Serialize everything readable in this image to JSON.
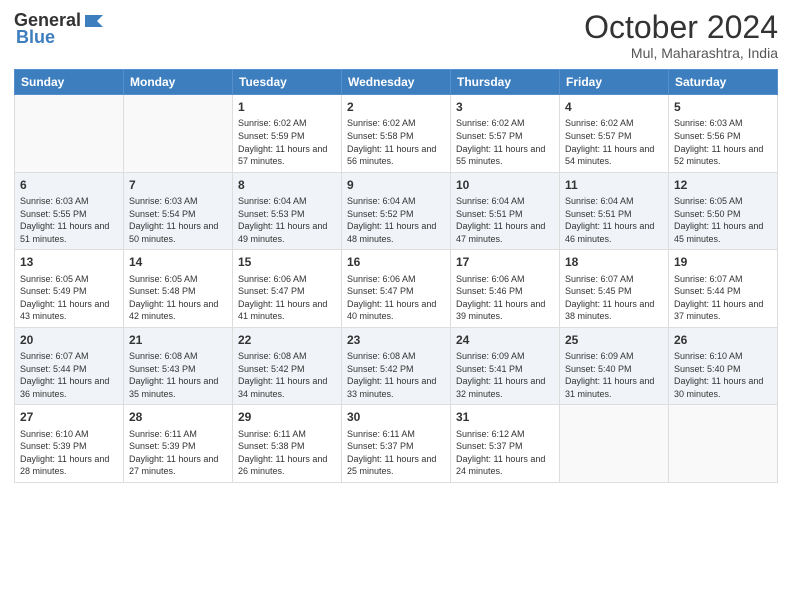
{
  "header": {
    "logo_general": "General",
    "logo_blue": "Blue",
    "month_title": "October 2024",
    "location": "Mul, Maharashtra, India"
  },
  "days_of_week": [
    "Sunday",
    "Monday",
    "Tuesday",
    "Wednesday",
    "Thursday",
    "Friday",
    "Saturday"
  ],
  "weeks": [
    [
      {
        "day": "",
        "sunrise": "",
        "sunset": "",
        "daylight": ""
      },
      {
        "day": "",
        "sunrise": "",
        "sunset": "",
        "daylight": ""
      },
      {
        "day": "1",
        "sunrise": "Sunrise: 6:02 AM",
        "sunset": "Sunset: 5:59 PM",
        "daylight": "Daylight: 11 hours and 57 minutes."
      },
      {
        "day": "2",
        "sunrise": "Sunrise: 6:02 AM",
        "sunset": "Sunset: 5:58 PM",
        "daylight": "Daylight: 11 hours and 56 minutes."
      },
      {
        "day": "3",
        "sunrise": "Sunrise: 6:02 AM",
        "sunset": "Sunset: 5:57 PM",
        "daylight": "Daylight: 11 hours and 55 minutes."
      },
      {
        "day": "4",
        "sunrise": "Sunrise: 6:02 AM",
        "sunset": "Sunset: 5:57 PM",
        "daylight": "Daylight: 11 hours and 54 minutes."
      },
      {
        "day": "5",
        "sunrise": "Sunrise: 6:03 AM",
        "sunset": "Sunset: 5:56 PM",
        "daylight": "Daylight: 11 hours and 52 minutes."
      }
    ],
    [
      {
        "day": "6",
        "sunrise": "Sunrise: 6:03 AM",
        "sunset": "Sunset: 5:55 PM",
        "daylight": "Daylight: 11 hours and 51 minutes."
      },
      {
        "day": "7",
        "sunrise": "Sunrise: 6:03 AM",
        "sunset": "Sunset: 5:54 PM",
        "daylight": "Daylight: 11 hours and 50 minutes."
      },
      {
        "day": "8",
        "sunrise": "Sunrise: 6:04 AM",
        "sunset": "Sunset: 5:53 PM",
        "daylight": "Daylight: 11 hours and 49 minutes."
      },
      {
        "day": "9",
        "sunrise": "Sunrise: 6:04 AM",
        "sunset": "Sunset: 5:52 PM",
        "daylight": "Daylight: 11 hours and 48 minutes."
      },
      {
        "day": "10",
        "sunrise": "Sunrise: 6:04 AM",
        "sunset": "Sunset: 5:51 PM",
        "daylight": "Daylight: 11 hours and 47 minutes."
      },
      {
        "day": "11",
        "sunrise": "Sunrise: 6:04 AM",
        "sunset": "Sunset: 5:51 PM",
        "daylight": "Daylight: 11 hours and 46 minutes."
      },
      {
        "day": "12",
        "sunrise": "Sunrise: 6:05 AM",
        "sunset": "Sunset: 5:50 PM",
        "daylight": "Daylight: 11 hours and 45 minutes."
      }
    ],
    [
      {
        "day": "13",
        "sunrise": "Sunrise: 6:05 AM",
        "sunset": "Sunset: 5:49 PM",
        "daylight": "Daylight: 11 hours and 43 minutes."
      },
      {
        "day": "14",
        "sunrise": "Sunrise: 6:05 AM",
        "sunset": "Sunset: 5:48 PM",
        "daylight": "Daylight: 11 hours and 42 minutes."
      },
      {
        "day": "15",
        "sunrise": "Sunrise: 6:06 AM",
        "sunset": "Sunset: 5:47 PM",
        "daylight": "Daylight: 11 hours and 41 minutes."
      },
      {
        "day": "16",
        "sunrise": "Sunrise: 6:06 AM",
        "sunset": "Sunset: 5:47 PM",
        "daylight": "Daylight: 11 hours and 40 minutes."
      },
      {
        "day": "17",
        "sunrise": "Sunrise: 6:06 AM",
        "sunset": "Sunset: 5:46 PM",
        "daylight": "Daylight: 11 hours and 39 minutes."
      },
      {
        "day": "18",
        "sunrise": "Sunrise: 6:07 AM",
        "sunset": "Sunset: 5:45 PM",
        "daylight": "Daylight: 11 hours and 38 minutes."
      },
      {
        "day": "19",
        "sunrise": "Sunrise: 6:07 AM",
        "sunset": "Sunset: 5:44 PM",
        "daylight": "Daylight: 11 hours and 37 minutes."
      }
    ],
    [
      {
        "day": "20",
        "sunrise": "Sunrise: 6:07 AM",
        "sunset": "Sunset: 5:44 PM",
        "daylight": "Daylight: 11 hours and 36 minutes."
      },
      {
        "day": "21",
        "sunrise": "Sunrise: 6:08 AM",
        "sunset": "Sunset: 5:43 PM",
        "daylight": "Daylight: 11 hours and 35 minutes."
      },
      {
        "day": "22",
        "sunrise": "Sunrise: 6:08 AM",
        "sunset": "Sunset: 5:42 PM",
        "daylight": "Daylight: 11 hours and 34 minutes."
      },
      {
        "day": "23",
        "sunrise": "Sunrise: 6:08 AM",
        "sunset": "Sunset: 5:42 PM",
        "daylight": "Daylight: 11 hours and 33 minutes."
      },
      {
        "day": "24",
        "sunrise": "Sunrise: 6:09 AM",
        "sunset": "Sunset: 5:41 PM",
        "daylight": "Daylight: 11 hours and 32 minutes."
      },
      {
        "day": "25",
        "sunrise": "Sunrise: 6:09 AM",
        "sunset": "Sunset: 5:40 PM",
        "daylight": "Daylight: 11 hours and 31 minutes."
      },
      {
        "day": "26",
        "sunrise": "Sunrise: 6:10 AM",
        "sunset": "Sunset: 5:40 PM",
        "daylight": "Daylight: 11 hours and 30 minutes."
      }
    ],
    [
      {
        "day": "27",
        "sunrise": "Sunrise: 6:10 AM",
        "sunset": "Sunset: 5:39 PM",
        "daylight": "Daylight: 11 hours and 28 minutes."
      },
      {
        "day": "28",
        "sunrise": "Sunrise: 6:11 AM",
        "sunset": "Sunset: 5:39 PM",
        "daylight": "Daylight: 11 hours and 27 minutes."
      },
      {
        "day": "29",
        "sunrise": "Sunrise: 6:11 AM",
        "sunset": "Sunset: 5:38 PM",
        "daylight": "Daylight: 11 hours and 26 minutes."
      },
      {
        "day": "30",
        "sunrise": "Sunrise: 6:11 AM",
        "sunset": "Sunset: 5:37 PM",
        "daylight": "Daylight: 11 hours and 25 minutes."
      },
      {
        "day": "31",
        "sunrise": "Sunrise: 6:12 AM",
        "sunset": "Sunset: 5:37 PM",
        "daylight": "Daylight: 11 hours and 24 minutes."
      },
      {
        "day": "",
        "sunrise": "",
        "sunset": "",
        "daylight": ""
      },
      {
        "day": "",
        "sunrise": "",
        "sunset": "",
        "daylight": ""
      }
    ]
  ]
}
